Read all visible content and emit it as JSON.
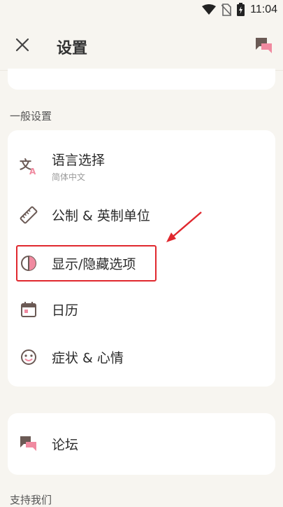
{
  "status": {
    "time": "11:04"
  },
  "header": {
    "title": "设置"
  },
  "sections": {
    "general": "一般设置",
    "support": "支持我们"
  },
  "general_items": [
    {
      "label": "语言选择",
      "sub": "简体中文",
      "icon": "translate-icon"
    },
    {
      "label": "公制 & 英制单位",
      "icon": "ruler-icon"
    },
    {
      "label": "显示/隐藏选项",
      "icon": "show-hide-icon"
    },
    {
      "label": "日历",
      "icon": "calendar-icon"
    },
    {
      "label": "症状 & 心情",
      "icon": "mood-icon"
    }
  ],
  "forum_item": {
    "label": "论坛",
    "icon": "forum-icon"
  },
  "colors": {
    "accent": "#f08aa0",
    "icon": "#6b5a55",
    "highlight": "#e0282e"
  }
}
